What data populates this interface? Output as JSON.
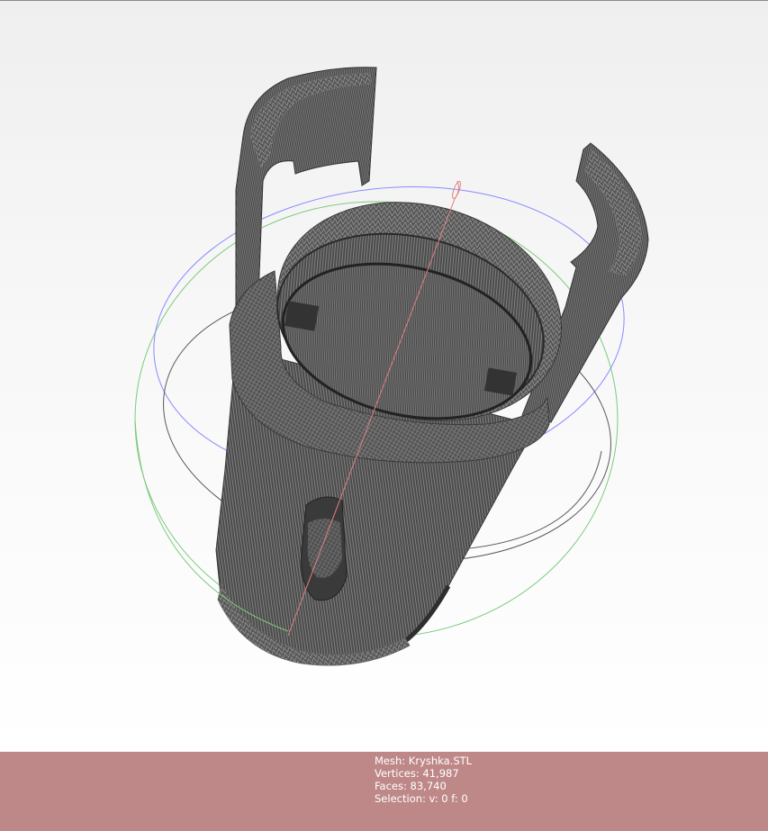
{
  "colors": {
    "info_panel_background": "#bf8888",
    "info_text": "#ffffff",
    "mesh_fill": "#4a4a4a",
    "wire_lines": "#9e9e9e",
    "trackball_x": "#7ccb7c",
    "trackball_y": "#8a8aff",
    "trackball_z": "#5a5a5a",
    "axis_line": "#e08080"
  },
  "viewport": {
    "model_name": "Kryshka.STL",
    "icons": [
      "trackball-gizmo-icon"
    ]
  },
  "info": {
    "mesh": "Mesh: Kryshka.STL",
    "vertices": "Vertices: 41,987",
    "faces": "Faces: 83,740",
    "selection": "Selection: v: 0 f: 0"
  }
}
